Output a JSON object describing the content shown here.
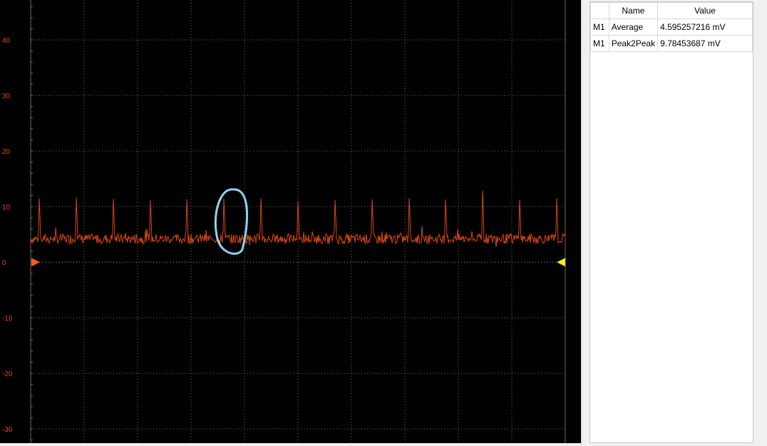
{
  "scope": {
    "y_axis_labels": [
      "40",
      "30",
      "20",
      "10",
      "0",
      "-10",
      "-20",
      "-30"
    ],
    "trace_color": "#d9470f",
    "axis_label_color": "#e0471a",
    "grid_color": "#6d6d6d",
    "background_color": "#000000",
    "ground_marker_color": "#ff5a1e",
    "trigger_marker_color": "#ffe81a",
    "annotation_color": "#8fd3f0",
    "trace": {
      "baseline_level": 4.2,
      "noise_amplitude": 0.9,
      "spike_levels": [
        11.5,
        11.6,
        11.4,
        11.2,
        11.3,
        11.4,
        11.5,
        11.0,
        11.2,
        11.3,
        11.5,
        11.3,
        12.9,
        11.2,
        11.5
      ]
    }
  },
  "measurements": {
    "headers": {
      "channel": "",
      "name": "Name",
      "value": "Value"
    },
    "rows": [
      {
        "channel": "M1",
        "name": "Average",
        "value": "4.595257216 mV"
      },
      {
        "channel": "M1",
        "name": "Peak2Peak",
        "value": "9.78453687 mV"
      }
    ]
  }
}
